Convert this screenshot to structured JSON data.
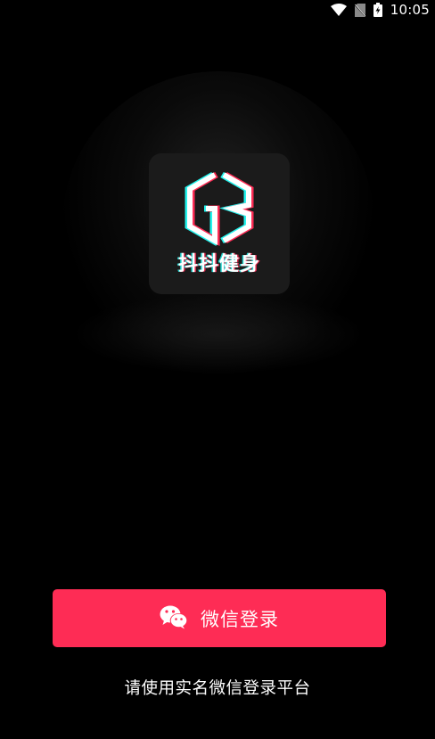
{
  "status_bar": {
    "time": "10:05",
    "icons": [
      "wifi-icon",
      "no-sim-icon",
      "battery-charging-icon"
    ]
  },
  "app": {
    "logo_text": "抖抖健身"
  },
  "login": {
    "button_label": "微信登录",
    "button_icon": "wechat-icon",
    "hint": "请使用实名微信登录平台"
  },
  "colors": {
    "background": "#000000",
    "accent": "#fe2c55",
    "logo_tile": "#1b1b1b",
    "cyan": "#25f4ee"
  }
}
